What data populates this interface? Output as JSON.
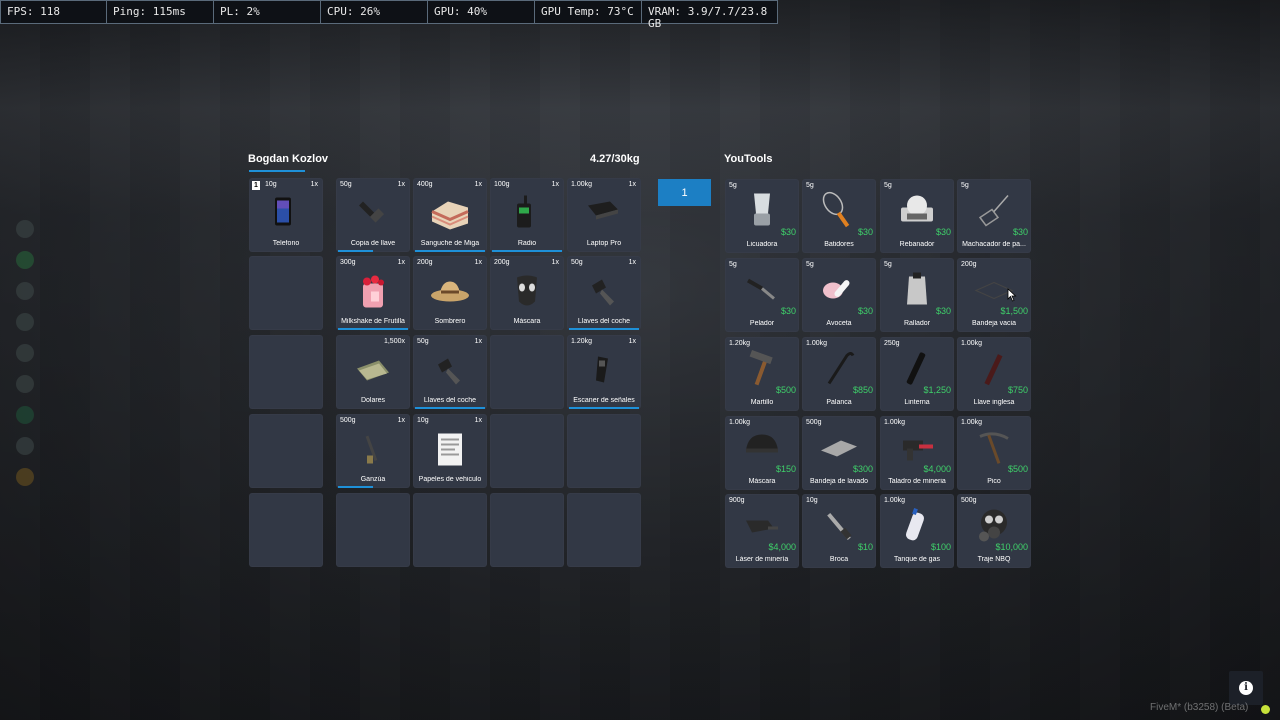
{
  "perf": [
    "FPS: 118",
    "Ping: 115ms",
    "PL: 2%",
    "CPU: 26%",
    "GPU: 40%",
    "GPU Temp: 73°C",
    "VRAM: 3.9/7.7/23.8 GB"
  ],
  "player": {
    "name": "Bogdan Kozlov",
    "weight": "4.27/30kg",
    "hotbar_number": "1"
  },
  "amount_value": "1",
  "shop": {
    "name": "YouTools"
  },
  "inv": [
    {
      "w": "10g",
      "q": "1x",
      "n": "Telefono",
      "bar": "none",
      "icon": "phone-icon",
      "num": "1"
    },
    {
      "w": "50g",
      "q": "1x",
      "n": "Copia de llave",
      "bar": "half",
      "icon": "key-icon"
    },
    {
      "w": "400g",
      "q": "1x",
      "n": "Sanguche de Miga",
      "bar": "full",
      "icon": "sandwich-icon"
    },
    {
      "w": "100g",
      "q": "1x",
      "n": "Radio",
      "bar": "full",
      "icon": "radio-icon"
    },
    {
      "w": "1.00kg",
      "q": "1x",
      "n": "Laptop Pro",
      "bar": "none",
      "icon": "laptop-icon"
    },
    {
      "w": "300g",
      "q": "1x",
      "n": "Milkshake de Frutilla",
      "bar": "full",
      "icon": "milkshake-icon"
    },
    {
      "w": "200g",
      "q": "1x",
      "n": "Sombrero",
      "bar": "none",
      "icon": "hat-icon"
    },
    {
      "w": "200g",
      "q": "1x",
      "n": "Máscara",
      "bar": "none",
      "icon": "mask-icon"
    },
    {
      "w": "50g",
      "q": "1x",
      "n": "Llaves del coche",
      "bar": "full",
      "icon": "car-key-icon"
    },
    {
      "w": "",
      "q": "1,500x",
      "n": "Dolares",
      "bar": "none",
      "icon": "cash-icon"
    },
    {
      "w": "50g",
      "q": "1x",
      "n": "Llaves del coche",
      "bar": "full",
      "icon": "car-key-icon"
    },
    {
      "w": "1.20kg",
      "q": "1x",
      "n": "Escaner de señales",
      "bar": "full",
      "icon": "scanner-icon"
    },
    {
      "w": "500g",
      "q": "1x",
      "n": "Ganzúa",
      "bar": "half",
      "icon": "lockpick-icon"
    },
    {
      "w": "10g",
      "q": "1x",
      "n": "Papeles de vehiculo",
      "bar": "none",
      "icon": "paper-icon"
    }
  ],
  "shop_items": [
    {
      "w": "5g",
      "n": "Licuadora",
      "p": "$30",
      "icon": "blender-icon"
    },
    {
      "w": "5g",
      "n": "Batidores",
      "p": "$30",
      "icon": "whisk-icon"
    },
    {
      "w": "5g",
      "n": "Rebanador",
      "p": "$30",
      "icon": "slicer-icon"
    },
    {
      "w": "5g",
      "n": "Machacador de pa...",
      "p": "$30",
      "icon": "masher-icon"
    },
    {
      "w": "5g",
      "n": "Pelador",
      "p": "$30",
      "icon": "peeler-icon"
    },
    {
      "w": "5g",
      "n": "Avoceta",
      "p": "$30",
      "icon": "scoop-icon"
    },
    {
      "w": "5g",
      "n": "Rallador",
      "p": "$30",
      "icon": "grater-icon"
    },
    {
      "w": "200g",
      "n": "Bandeja vacia",
      "p": "$1,500",
      "icon": "tray-icon"
    },
    {
      "w": "1.20kg",
      "n": "Martillo",
      "p": "$500",
      "icon": "hammer-icon"
    },
    {
      "w": "1.00kg",
      "n": "Palanca",
      "p": "$850",
      "icon": "crowbar-icon"
    },
    {
      "w": "250g",
      "n": "Linterna",
      "p": "$1,250",
      "icon": "flashlight-icon"
    },
    {
      "w": "1.00kg",
      "n": "Llave inglesa",
      "p": "$750",
      "icon": "wrench-icon"
    },
    {
      "w": "1.00kg",
      "n": "Máscara",
      "p": "$150",
      "icon": "helmet-icon"
    },
    {
      "w": "500g",
      "n": "Bandeja de lavado",
      "p": "$300",
      "icon": "wash-tray-icon"
    },
    {
      "w": "1.00kg",
      "n": "Taladro de mineria",
      "p": "$4,000",
      "icon": "drill-icon"
    },
    {
      "w": "1.00kg",
      "n": "Pico",
      "p": "$500",
      "icon": "pickaxe-icon"
    },
    {
      "w": "900g",
      "n": "Láser de minería",
      "p": "$4,000",
      "icon": "laser-icon"
    },
    {
      "w": "10g",
      "n": "Broca",
      "p": "$10",
      "icon": "drill-bit-icon"
    },
    {
      "w": "1.00kg",
      "n": "Tanque de gas",
      "p": "$100",
      "icon": "gas-tank-icon"
    },
    {
      "w": "500g",
      "n": "Traje NBQ",
      "p": "$10,000",
      "icon": "gas-mask-icon"
    }
  ],
  "watermark": "FiveM* (b3258) (Beta)",
  "info_icon_char": "i"
}
